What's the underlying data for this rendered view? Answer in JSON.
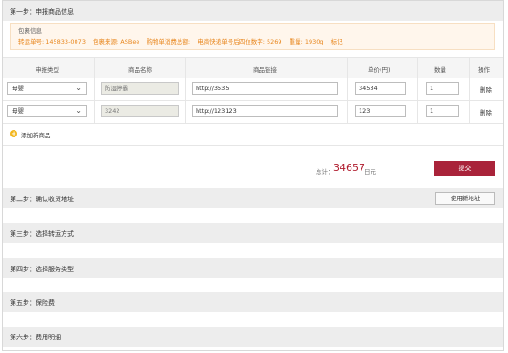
{
  "step1": {
    "title": "第一步：申报商品信息",
    "notice_head": "包裹信息",
    "info": {
      "tracking": "转运单号: 145833-0073",
      "source": "包裹来源: ASBee",
      "amount": "购物单消费总额:",
      "last4": "电商快递单号后四位数字: 5269",
      "weight": "重量: 1930g",
      "mark": "标记"
    },
    "columns": [
      "申报类型",
      "商品名称",
      "商品链接",
      "单价(円)",
      "数量",
      "操作"
    ],
    "rows": [
      {
        "type": "母婴",
        "name": "",
        "name_placeholder": "防湿停霸",
        "link": "http://3535",
        "price": "34534",
        "qty": "1",
        "action": "删除"
      },
      {
        "type": "母婴",
        "name": "3242",
        "name_placeholder": "",
        "link": "http://123123",
        "price": "123",
        "qty": "1",
        "action": "删除"
      }
    ],
    "add_label": "添加新商品",
    "total_label": "总计：",
    "total_value": "34657",
    "total_unit": "日元",
    "submit_label": "提交"
  },
  "step2": {
    "title": "第二步：确认收货地址",
    "new_address_label": "使用新地址"
  },
  "step3": {
    "title": "第三步：选择转运方式"
  },
  "step4": {
    "title": "第四步：选择服务类型"
  },
  "step5": {
    "title": "第五步：保险费"
  },
  "step6": {
    "title": "第六步：费用明细"
  },
  "colors": {
    "accent": "#a9233a",
    "total": "#b01c2e",
    "info": "#e8871e",
    "add_icon": "#f2b51a"
  }
}
